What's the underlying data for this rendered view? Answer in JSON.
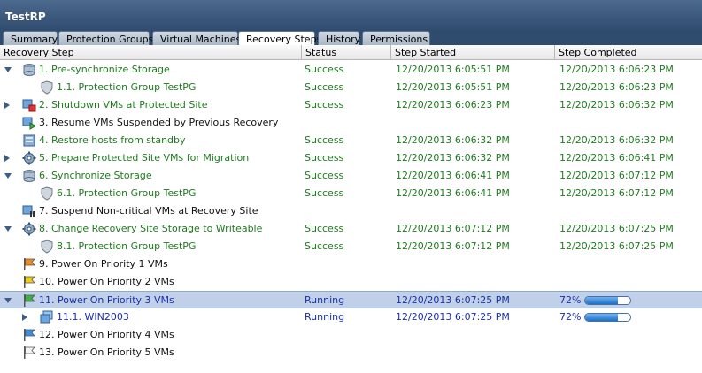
{
  "window": {
    "title": "TestRP"
  },
  "tabs": [
    {
      "label": "Summary",
      "active": false
    },
    {
      "label": "Protection Groups",
      "active": false
    },
    {
      "label": "Virtual Machines",
      "active": false
    },
    {
      "label": "Recovery Steps",
      "active": true
    },
    {
      "label": "History",
      "active": false
    },
    {
      "label": "Permissions",
      "active": false
    }
  ],
  "columns": [
    "Recovery Step",
    "Status",
    "Step Started",
    "Step Completed"
  ],
  "colors": {
    "success": "#207a20",
    "running": "#1a2fa8",
    "progress_fill": "#1d6fc9",
    "selected_row": "#bfd0e8"
  },
  "rows": [
    {
      "step": "1. Pre-synchronize Storage",
      "status": "Success",
      "started": "12/20/2013 6:05:51 PM",
      "completed": "12/20/2013 6:06:23 PM",
      "level": 0,
      "expander": "down",
      "icon": "storage-icon",
      "color": "green"
    },
    {
      "step": "1.1. Protection Group TestPG",
      "status": "Success",
      "started": "12/20/2013 6:05:51 PM",
      "completed": "12/20/2013 6:06:23 PM",
      "level": 1,
      "expander": "",
      "icon": "shield-icon",
      "color": "green"
    },
    {
      "step": "2. Shutdown VMs at Protected Site",
      "status": "Success",
      "started": "12/20/2013 6:06:23 PM",
      "completed": "12/20/2013 6:06:32 PM",
      "level": 0,
      "expander": "right",
      "icon": "vm-shutdown-icon",
      "color": "green"
    },
    {
      "step": "3. Resume VMs Suspended by Previous Recovery",
      "status": "",
      "started": "",
      "completed": "",
      "level": 0,
      "expander": "",
      "icon": "vm-resume-icon",
      "color": "black"
    },
    {
      "step": "4. Restore hosts from standby",
      "status": "Success",
      "started": "12/20/2013 6:06:32 PM",
      "completed": "12/20/2013 6:06:32 PM",
      "level": 0,
      "expander": "",
      "icon": "host-icon",
      "color": "green"
    },
    {
      "step": "5. Prepare Protected Site VMs for Migration",
      "status": "Success",
      "started": "12/20/2013 6:06:32 PM",
      "completed": "12/20/2013 6:06:41 PM",
      "level": 0,
      "expander": "right",
      "icon": "gear-storage-icon",
      "color": "green"
    },
    {
      "step": "6. Synchronize Storage",
      "status": "Success",
      "started": "12/20/2013 6:06:41 PM",
      "completed": "12/20/2013 6:07:12 PM",
      "level": 0,
      "expander": "down",
      "icon": "storage-icon",
      "color": "green"
    },
    {
      "step": "6.1. Protection Group TestPG",
      "status": "Success",
      "started": "12/20/2013 6:06:41 PM",
      "completed": "12/20/2013 6:07:12 PM",
      "level": 1,
      "expander": "",
      "icon": "shield-icon",
      "color": "green"
    },
    {
      "step": "7. Suspend Non-critical VMs at Recovery Site",
      "status": "",
      "started": "",
      "completed": "",
      "level": 0,
      "expander": "",
      "icon": "vm-suspend-icon",
      "color": "black"
    },
    {
      "step": "8. Change Recovery Site Storage to Writeable",
      "status": "Success",
      "started": "12/20/2013 6:07:12 PM",
      "completed": "12/20/2013 6:07:25 PM",
      "level": 0,
      "expander": "down",
      "icon": "gear-storage-icon",
      "color": "green"
    },
    {
      "step": "8.1. Protection Group TestPG",
      "status": "Success",
      "started": "12/20/2013 6:07:12 PM",
      "completed": "12/20/2013 6:07:25 PM",
      "level": 1,
      "expander": "",
      "icon": "shield-icon",
      "color": "green"
    },
    {
      "step": "9. Power On Priority 1 VMs",
      "status": "",
      "started": "",
      "completed": "",
      "level": 0,
      "expander": "",
      "icon": "flag-orange-icon",
      "color": "black"
    },
    {
      "step": "10. Power On Priority 2 VMs",
      "status": "",
      "started": "",
      "completed": "",
      "level": 0,
      "expander": "",
      "icon": "flag-yellow-icon",
      "color": "black"
    },
    {
      "step": "11. Power On Priority 3 VMs",
      "status": "Running",
      "started": "12/20/2013 6:07:25 PM",
      "completed": "72%",
      "progress": 0.72,
      "level": 0,
      "expander": "down",
      "icon": "flag-green-icon",
      "color": "blue",
      "selected": true
    },
    {
      "step": "11.1. WIN2003",
      "status": "Running",
      "started": "12/20/2013 6:07:25 PM",
      "completed": "72%",
      "progress": 0.72,
      "level": 1,
      "expander": "right",
      "icon": "vm-icon",
      "color": "blue"
    },
    {
      "step": "12. Power On Priority 4 VMs",
      "status": "",
      "started": "",
      "completed": "",
      "level": 0,
      "expander": "",
      "icon": "flag-blue-icon",
      "color": "black"
    },
    {
      "step": "13. Power On Priority 5 VMs",
      "status": "",
      "started": "",
      "completed": "",
      "level": 0,
      "expander": "",
      "icon": "flag-white-icon",
      "color": "black"
    }
  ]
}
